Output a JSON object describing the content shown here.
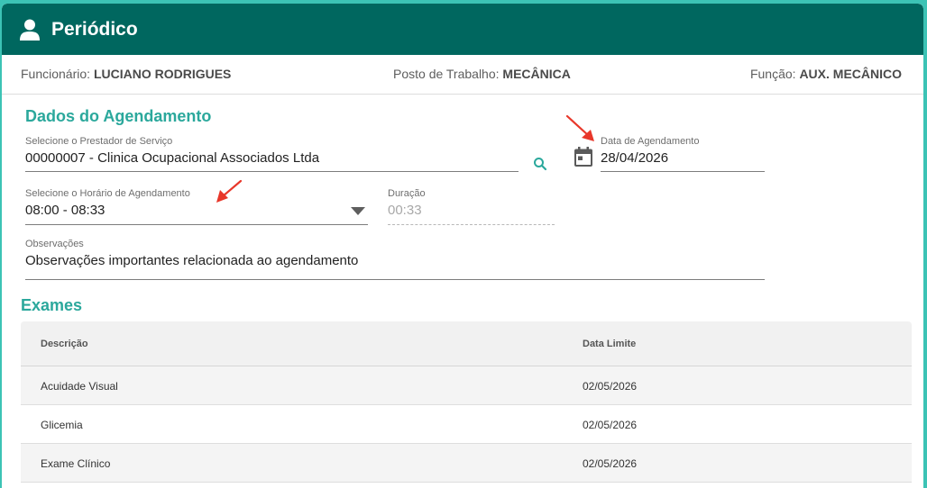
{
  "header": {
    "title": "Periódico"
  },
  "info": {
    "employee_label": "Funcionário:",
    "employee_value": "LUCIANO RODRIGUES",
    "workstation_label": "Posto de Trabalho:",
    "workstation_value": "MECÂNICA",
    "role_label": "Função:",
    "role_value": "AUX. MECÂNICO"
  },
  "scheduling": {
    "title": "Dados do Agendamento",
    "provider_label": "Selecione o Prestador de Serviço",
    "provider_value": "00000007 - Clinica Ocupacional Associados Ltda",
    "date_label": "Data de Agendamento",
    "date_value": "28/04/2026",
    "time_label": "Selecione o Horário de Agendamento",
    "time_value": "08:00 - 08:33",
    "duration_label": "Duração",
    "duration_value": "00:33",
    "notes_label": "Observações",
    "notes_value": "Observações importantes relacionada ao agendamento"
  },
  "exams": {
    "title": "Exames",
    "columns": [
      "Descrição",
      "Data Limite"
    ],
    "rows": [
      {
        "description": "Acuidade Visual",
        "deadline": "02/05/2026"
      },
      {
        "description": "Glicemia",
        "deadline": "02/05/2026"
      },
      {
        "description": "Exame Clínico",
        "deadline": "02/05/2026"
      }
    ]
  },
  "colors": {
    "header_bg": "#00675f",
    "accent": "#2ba89c",
    "page_bg": "#3cc3b5",
    "annotation_arrow": "#e8372a"
  },
  "icons": {
    "header": "user-icon",
    "provider_search": "search-icon",
    "date": "calendar-icon",
    "time_dropdown": "caret-down-icon"
  }
}
